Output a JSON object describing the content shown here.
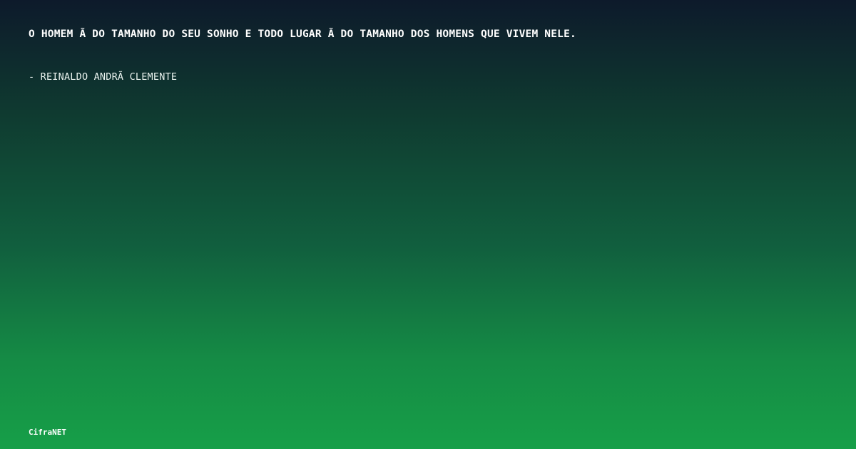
{
  "quote": {
    "text": "O HOMEM Ã  DO TAMANHO DO SEU SONHO E TODO LUGAR Ã  DO TAMANHO DOS HOMENS QUE VIVEM NELE.",
    "author": "- REINALDO ANDRÃ  CLEMENTE"
  },
  "brand": {
    "name": "CifraNET"
  },
  "colors": {
    "gradient_top": "#0d1a2b",
    "gradient_bottom": "#169f48",
    "text": "#ffffff"
  }
}
